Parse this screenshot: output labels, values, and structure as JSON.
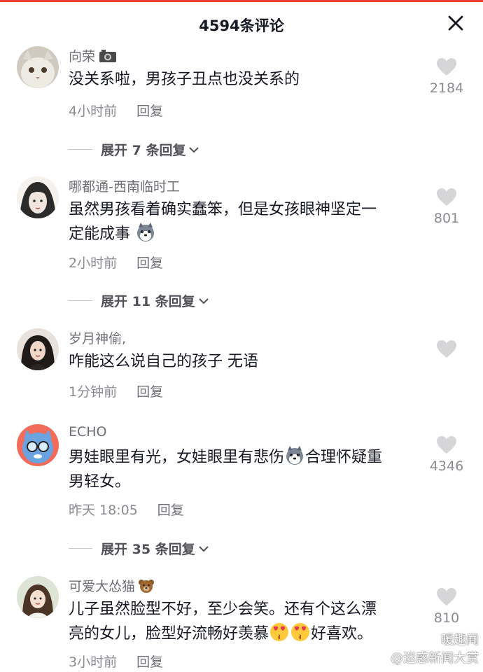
{
  "header": {
    "title": "4594条评论"
  },
  "colors": {
    "accent_line": "#e8402f",
    "name_gray": "#6e6f75",
    "meta_gray": "#8a8b91",
    "like_gray": "#d6d6d8"
  },
  "comments": [
    {
      "name": "向荣",
      "badge_icon": "camera-icon",
      "text": "没关系啦，男孩子丑点也没关系的",
      "time": "4小时前",
      "reply": "回复",
      "likes": "2184",
      "expand": "展开 7 条回复"
    },
    {
      "name": "哪都通-西南临时工",
      "text_lines": [
        "虽然男孩看着确实蠢笨，但是女孩眼神坚定一",
        "定能成事"
      ],
      "time": "2小时前",
      "reply": "回复",
      "likes": "801",
      "expand": "展开 11 条回复"
    },
    {
      "name": "岁月神偷,",
      "text": "咋能这么说自己的孩子 无语",
      "time": "1分钟前",
      "reply": "回复",
      "likes": ""
    },
    {
      "name": "ECHO",
      "text_lines": [
        "男娃眼里有光，女娃眼里有悲伤",
        "合理怀疑重",
        "男轻女。"
      ],
      "time": "昨天 18:05",
      "reply": "回复",
      "likes": "4346",
      "expand": "展开 35 条回复"
    },
    {
      "name": "可爱大怂猫",
      "badge_icon": "bear-emoji",
      "text_lines": [
        "儿子虽然脸型不好，至少会笑。还有个这么漂",
        "亮的女儿，脸型好流畅好羡慕",
        "好喜欢。"
      ],
      "time": "3小时前",
      "reply": "回复",
      "likes": "810"
    }
  ],
  "watermark": {
    "line1": "暖趣闻",
    "line2": "@迷惑新闻大赏"
  }
}
